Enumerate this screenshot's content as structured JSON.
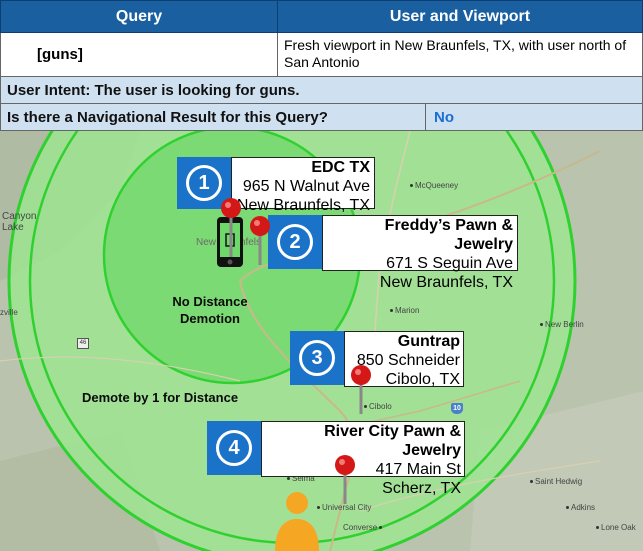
{
  "header": {
    "col_query": "Query",
    "col_user_viewport": "User and Viewport"
  },
  "row_query": {
    "query": "[guns]",
    "viewport": "Fresh viewport in New Braunfels, TX, with user north of San Antonio"
  },
  "intent": "User Intent: The user is looking for guns.",
  "nav_question": {
    "label": "Is there a Navigational Result for this Query?",
    "answer": "No"
  },
  "map": {
    "zone_inner_label": "No Distance Demotion",
    "zone_outer_label": "Demote by 1 for Distance",
    "places": {
      "mcqueeney": "McQueeney",
      "canyon_lake": "Canyon Lake",
      "new_braunfels": "New Braunfels",
      "zville": "zville",
      "marion": "Marion",
      "new_berlin": "New Berlin",
      "cibolo": "Cibolo",
      "selma": "Selma",
      "universal_city": "Universal City",
      "converse": "Converse",
      "saint_hedwig": "Saint Hedwig",
      "adkins": "Adkins",
      "lone_oak": "Lone Oak",
      "hwy_46": "46",
      "hwy_10": "10"
    },
    "results": [
      {
        "number": "1",
        "name": "EDC TX",
        "address": "965 N Walnut Ave",
        "city": "New Braunfels, TX"
      },
      {
        "number": "2",
        "name": "Freddy’s Pawn & Jewelry",
        "address": "671 S Seguin Ave",
        "city": "New Braunfels, TX"
      },
      {
        "number": "3",
        "name": "Guntrap",
        "address": "850 Schneider",
        "city": "Cibolo, TX"
      },
      {
        "number": "4",
        "name": "River City Pawn & Jewelry",
        "address": "417 Main St",
        "city": "Scherz, TX"
      }
    ],
    "colors": {
      "inner_zone": "#6fd86a",
      "outer_zone": "#9be88f",
      "zone_border": "#2fd12f",
      "badge": "#1a73c9",
      "pin": "#d41818"
    }
  }
}
